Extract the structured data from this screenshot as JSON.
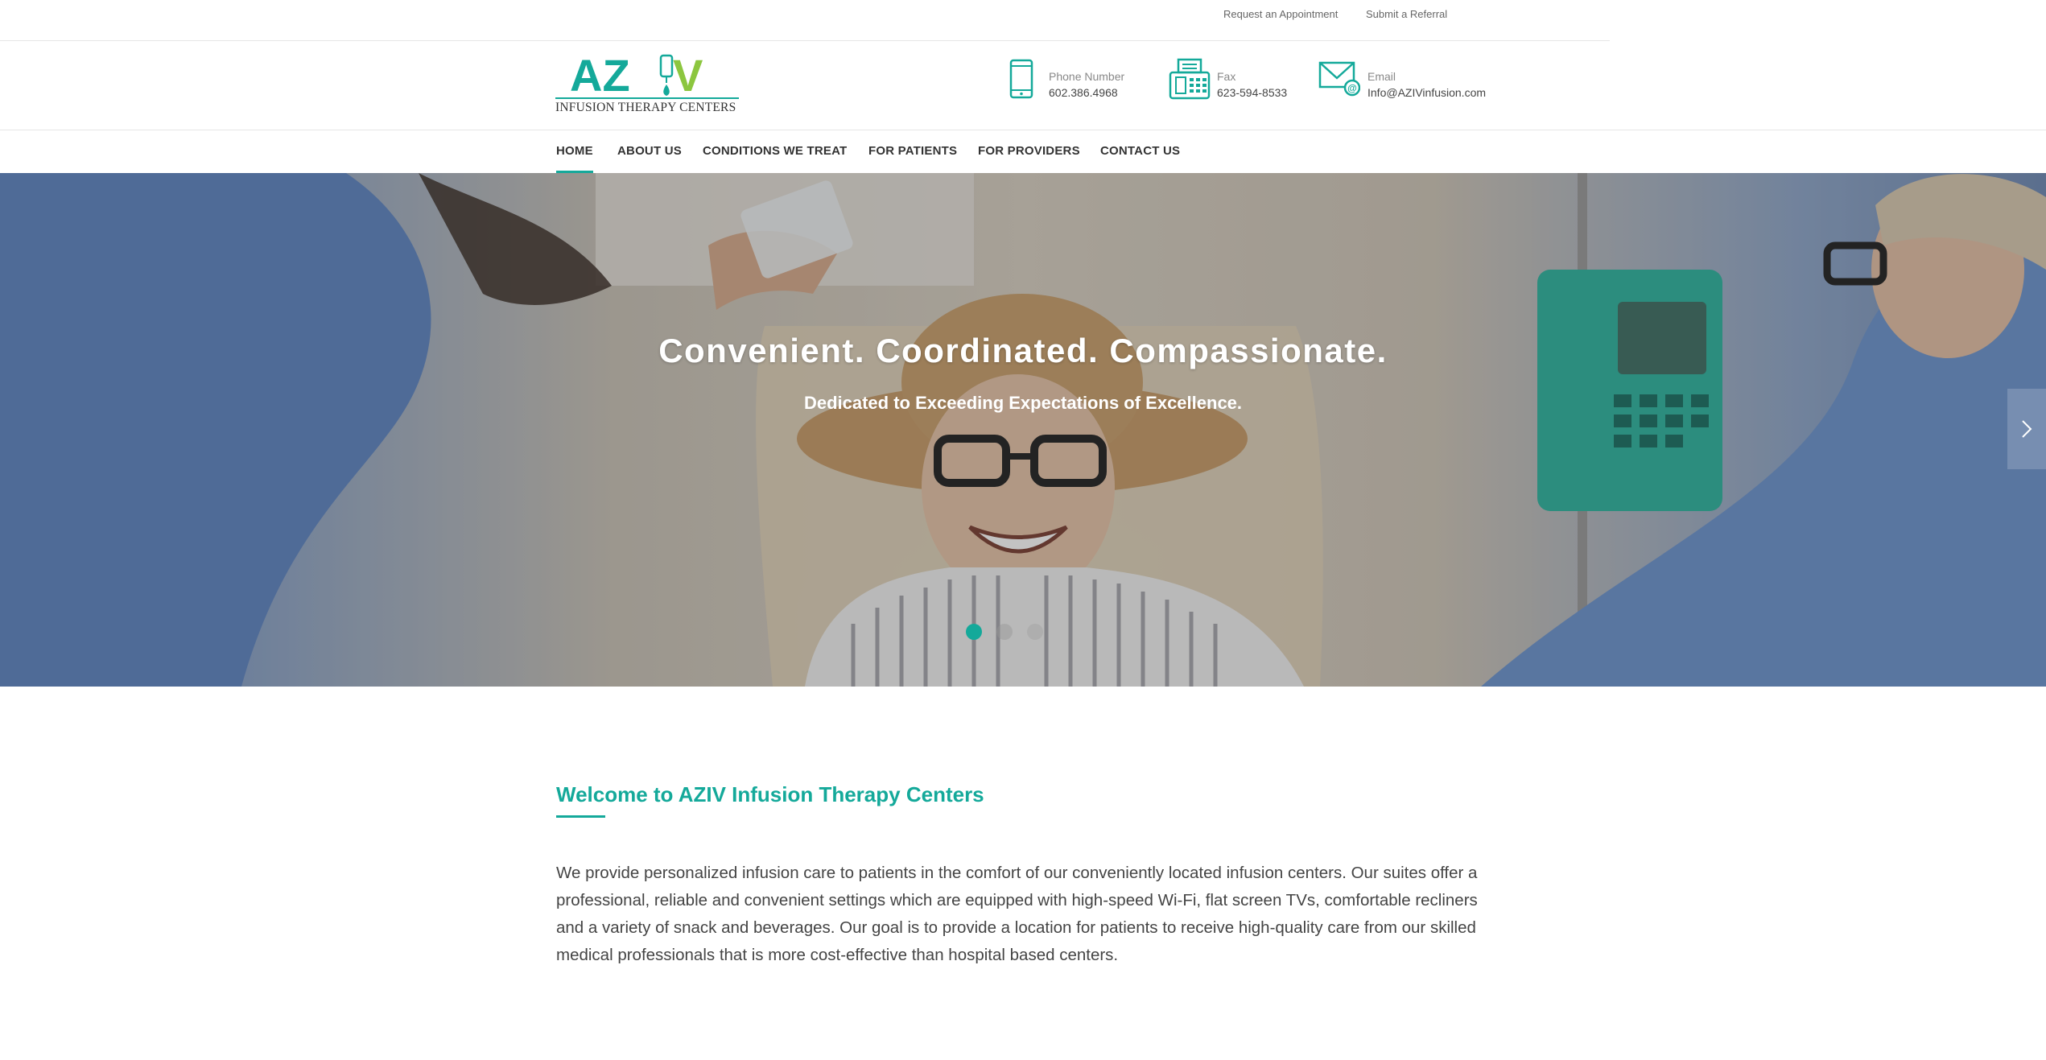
{
  "topbar": {
    "request_appointment": "Request an Appointment",
    "submit_referral": "Submit a Referral"
  },
  "logo": {
    "mark_left": "AZ",
    "mark_right": "V",
    "tagline": "INFUSION THERAPY CENTERS",
    "colors": {
      "teal": "#14a99a",
      "green": "#8cc63f"
    }
  },
  "contacts": [
    {
      "icon": "phone-icon",
      "label": "Phone Number",
      "value": "602.386.4968"
    },
    {
      "icon": "fax-icon",
      "label": "Fax",
      "value": "623-594-8533"
    },
    {
      "icon": "email-icon",
      "label": "Email",
      "value": "Info@AZIVinfusion.com"
    }
  ],
  "nav": {
    "items": [
      {
        "label": "HOME",
        "active": true
      },
      {
        "label": "ABOUT US",
        "active": false
      },
      {
        "label": "CONDITIONS WE TREAT",
        "active": false
      },
      {
        "label": "FOR PATIENTS",
        "active": false
      },
      {
        "label": "FOR PROVIDERS",
        "active": false
      },
      {
        "label": "CONTACT US",
        "active": false
      }
    ]
  },
  "hero": {
    "title": "Convenient. Coordinated. Compassionate.",
    "subtitle": "Dedicated to Exceeding Expectations of Excellence.",
    "slide_count": 3,
    "active_slide": 1,
    "next_icon": "chevron-right-icon"
  },
  "welcome": {
    "title": "Welcome to AZIV Infusion Therapy Centers",
    "body": "We provide personalized infusion care to patients in the comfort of our conveniently located infusion centers.  Our suites offer a professional, reliable and convenient settings which are equipped with high-speed Wi-Fi, flat screen TVs, comfortable recliners and a variety of snack and beverages. Our goal is to provide a location for patients to receive high-quality care from our skilled medical professionals that is more cost-effective than hospital based centers."
  },
  "colors": {
    "accent": "#14a99a",
    "brand_green": "#8cc63f"
  }
}
